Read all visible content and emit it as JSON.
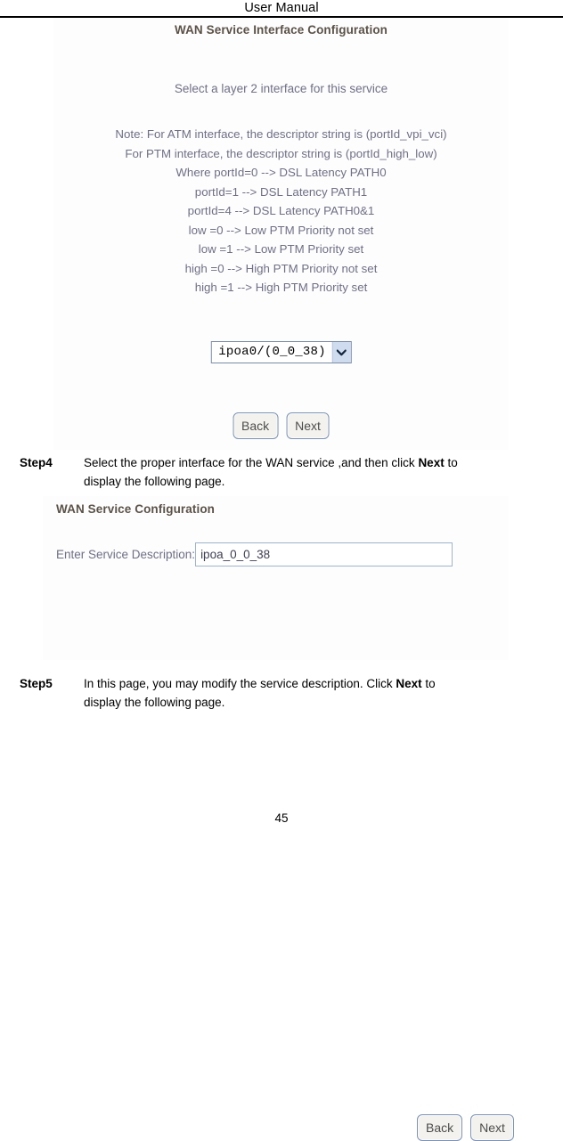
{
  "header": {
    "title": "User Manual"
  },
  "panel_interface": {
    "title": "WAN Service Interface Configuration",
    "subtitle": "Select a layer 2 interface for this service",
    "note_lines": [
      "Note: For ATM interface, the descriptor string is (portId_vpi_vci)",
      "For PTM interface, the descriptor string is (portId_high_low)",
      "Where portId=0 --> DSL Latency PATH0",
      "portId=1 --> DSL Latency PATH1",
      "portId=4 --> DSL Latency PATH0&1",
      "low =0 --> Low PTM Priority not set",
      "low =1 --> Low PTM Priority set",
      "high =0 --> High PTM Priority not set",
      "high =1 --> High PTM Priority set"
    ],
    "interface_select": {
      "value": "ipoa0/(0_0_38)",
      "options": [
        "ipoa0/(0_0_38)"
      ]
    },
    "buttons": {
      "back": "Back",
      "next": "Next"
    }
  },
  "panel_service": {
    "title": "WAN Service Configuration",
    "description_label": "Enter Service Description:",
    "description_value": "ipoa_0_0_38",
    "description_placeholder": "",
    "buttons": {
      "back": "Back",
      "next": "Next"
    }
  },
  "steps": [
    {
      "label": "Step4",
      "text_part1": "Select the proper interface for the WAN service ,and then click ",
      "emphasis": "Next",
      "text_part2": " to",
      "text_line2": "display the following page."
    },
    {
      "label": "Step5",
      "text_part1": "In this page, you may modify the service description. Click ",
      "emphasis": "Next",
      "text_part2": " to",
      "text_line2": "display the following page."
    }
  ],
  "footer": {
    "page_number": "45"
  },
  "colors": {
    "panel_background": "#fdfdfd",
    "heading": "#5b5248",
    "body_text": "#6f6f86",
    "button_border": "#7d93b5",
    "select_border": "#7b8ba6",
    "select_arrow_bg": "#cfdcf0",
    "input_border": "#9fb3cd"
  }
}
